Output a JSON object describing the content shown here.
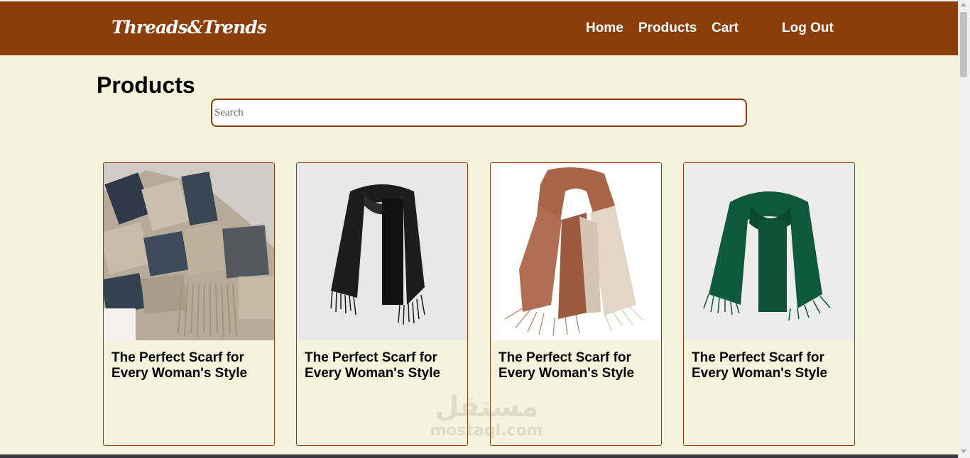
{
  "brand": {
    "name": "Threads&Trends"
  },
  "nav": {
    "home": "Home",
    "products": "Products",
    "cart": "Cart",
    "logout": "Log Out"
  },
  "main": {
    "title": "Products",
    "search_placeholder": "Search"
  },
  "products": [
    {
      "title": "The Perfect Scarf for Every Woman's Style",
      "image": "plaid-scarf",
      "color": "#6b6a5c"
    },
    {
      "title": "The Perfect Scarf for Every Woman's Style",
      "image": "black-scarf",
      "color": "#1a1a1a"
    },
    {
      "title": "The Perfect Scarf for Every Woman's Style",
      "image": "rust-cream-scarf",
      "color": "#a0644a"
    },
    {
      "title": "The Perfect Scarf for Every Woman's Style",
      "image": "green-scarf",
      "color": "#0f5a3c"
    }
  ],
  "colors": {
    "accent": "#8b3d0a",
    "background": "#f5f3dc"
  }
}
